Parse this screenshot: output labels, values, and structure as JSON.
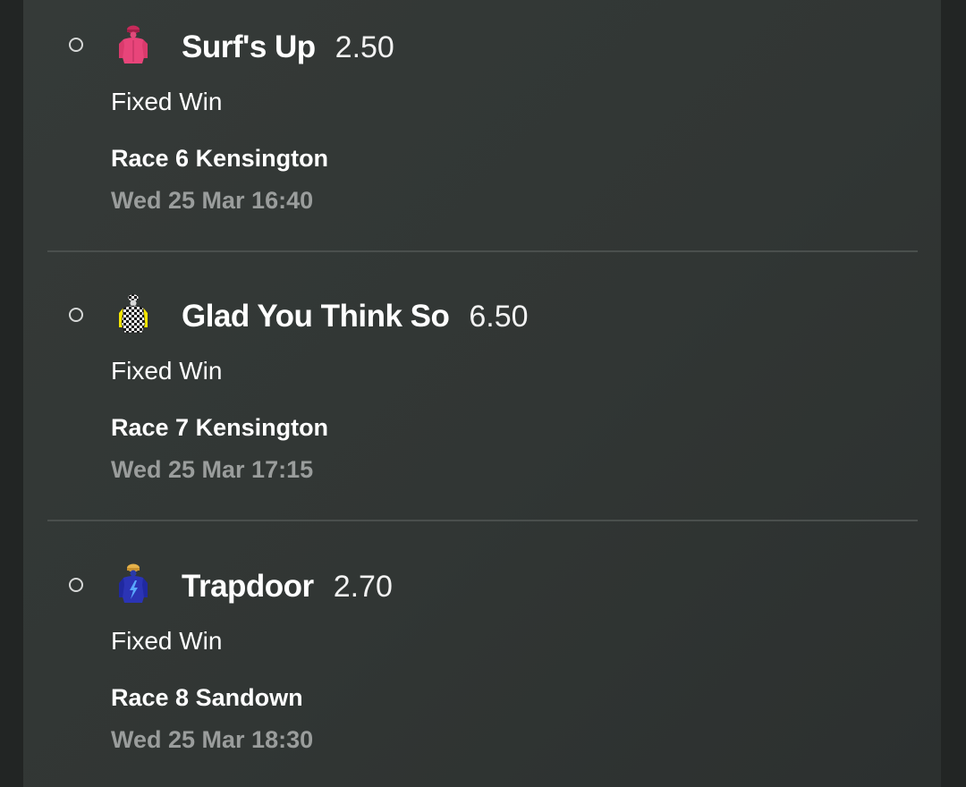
{
  "bets": [
    {
      "runner": "Surf's Up",
      "odds": "2.50",
      "bet_type": "Fixed Win",
      "race": "Race 6 Kensington",
      "time": "Wed 25 Mar 16:40",
      "silk_icon": "pink-jockey-silk-icon"
    },
    {
      "runner": "Glad You Think So",
      "odds": "6.50",
      "bet_type": "Fixed Win",
      "race": "Race 7 Kensington",
      "time": "Wed 25 Mar 17:15",
      "silk_icon": "checkered-yellow-jockey-silk-icon"
    },
    {
      "runner": "Trapdoor",
      "odds": "2.70",
      "bet_type": "Fixed Win",
      "race": "Race 8 Sandown",
      "time": "Wed 25 Mar 18:30",
      "silk_icon": "blue-lightning-jockey-silk-icon"
    }
  ],
  "colors": {
    "background": "#222524",
    "panel": "#333836",
    "text_primary": "#ffffff",
    "text_secondary": "#9a9d9c",
    "divider": "#4a4f4d"
  }
}
